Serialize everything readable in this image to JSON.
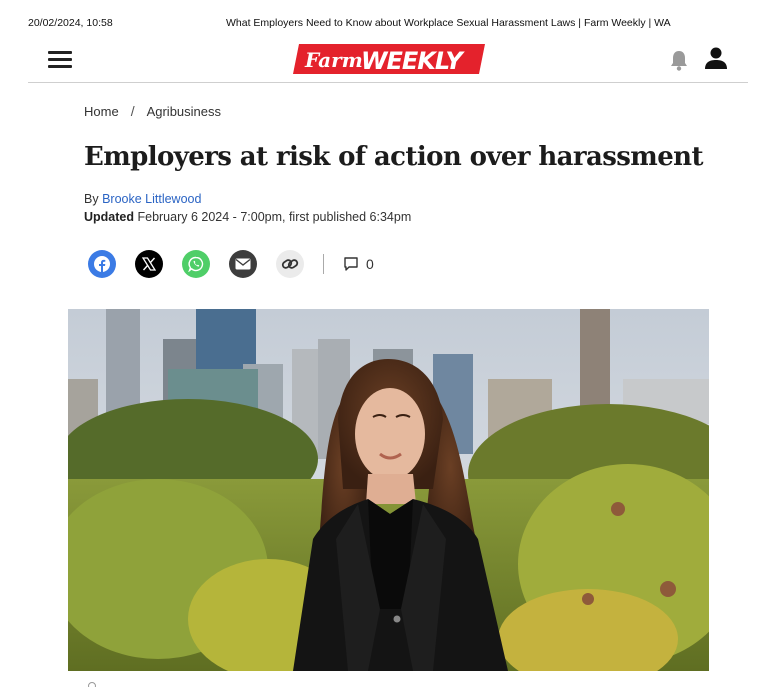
{
  "print": {
    "datetime": "20/02/2024, 10:58",
    "page_title": "What Employers Need to Know about Workplace Sexual Harassment Laws | Farm Weekly | WA"
  },
  "masthead": {
    "logo_part1": "Farm",
    "logo_part2": "WEEKLY",
    "brand_color": "#e4222c",
    "menu_icon": "hamburger-menu-icon",
    "notification_icon": "bell-icon",
    "account_icon": "user-icon"
  },
  "breadcrumb": {
    "items": [
      "Home",
      "Agribusiness"
    ],
    "separator": "/"
  },
  "article": {
    "headline": "Employers at risk of action over harassment",
    "by_prefix": "By",
    "author": "Brooke Littlewood",
    "updated_label": "Updated",
    "updated_text": "February 6 2024 - 7:00pm, first published 6:34pm",
    "author_link_color": "#2b64c4"
  },
  "share": {
    "buttons": [
      {
        "name": "facebook-share-button",
        "icon": "facebook-icon",
        "color": "#3b7be5"
      },
      {
        "name": "x-share-button",
        "icon": "x-icon",
        "color": "#000000"
      },
      {
        "name": "whatsapp-share-button",
        "icon": "whatsapp-icon",
        "color": "#4fce68"
      },
      {
        "name": "email-share-button",
        "icon": "envelope-icon",
        "color": "#3d3d3d"
      },
      {
        "name": "copy-link-button",
        "icon": "link-icon",
        "color": "#ebebeb"
      }
    ],
    "comment_icon": "comment-icon",
    "comment_count": "0"
  },
  "hero_image": {
    "subject": "photo-of-woman-in-black-blazer-with-city-skyline"
  }
}
